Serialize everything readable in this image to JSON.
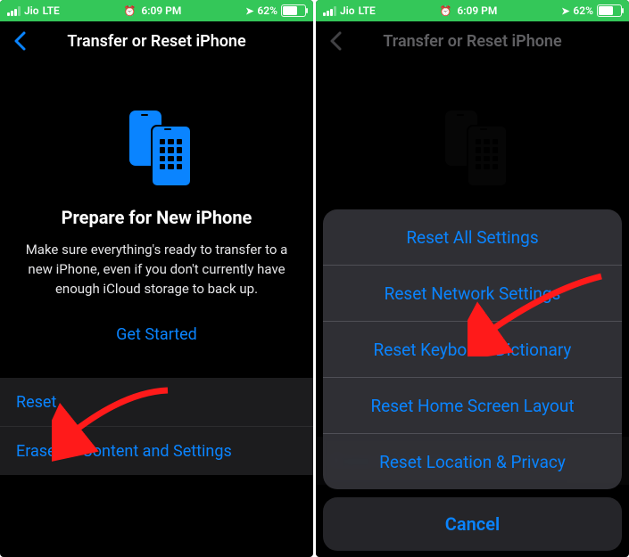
{
  "status": {
    "carrier": "Jio",
    "network": "LTE",
    "time": "6:09 PM",
    "battery": "62%"
  },
  "nav": {
    "title": "Transfer or Reset iPhone"
  },
  "prepare": {
    "title": "Prepare for New iPhone",
    "body": "Make sure everything's ready to transfer to a new iPhone, even if you don't currently have enough iCloud storage to back up.",
    "cta": "Get Started"
  },
  "rows": {
    "reset": "Reset",
    "erase": "Erase All Content and Settings"
  },
  "sheet": {
    "options": [
      "Reset All Settings",
      "Reset Network Settings",
      "Reset Keyboard Dictionary",
      "Reset Home Screen Layout",
      "Reset Location & Privacy"
    ],
    "cancel": "Cancel"
  }
}
